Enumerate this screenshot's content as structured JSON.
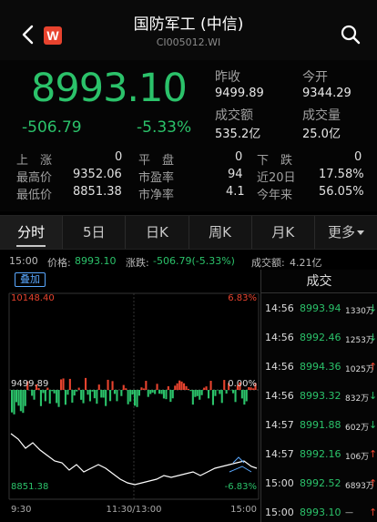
{
  "header": {
    "title": "国防军工 (中信)",
    "code": "CI005012.WI",
    "logo_letter": "W"
  },
  "quote": {
    "price": "8993.10",
    "change": "-506.79",
    "change_pct": "-5.33%",
    "prev_close_label": "昨收",
    "prev_close": "9499.89",
    "open_label": "今开",
    "open": "9344.29",
    "turnover_label": "成交额",
    "turnover": "535.2亿",
    "volume_label": "成交量",
    "volume": "25.0亿"
  },
  "stats": {
    "up_label": "上　涨",
    "up_value": "0",
    "flat_label": "平　盘",
    "flat_value": "0",
    "down_label": "下　跌",
    "down_value": "0",
    "high_label": "最高价",
    "high_value": "9352.06",
    "pe_label": "市盈率",
    "pe_value": "94",
    "d20_label": "近20日",
    "d20_value": "17.58%",
    "low_label": "最低价",
    "low_value": "8851.38",
    "pb_label": "市净率",
    "pb_value": "4.1",
    "ytd_label": "今年来",
    "ytd_value": "56.05%"
  },
  "tabs": [
    {
      "label": "分时"
    },
    {
      "label": "5日"
    },
    {
      "label": "日K"
    },
    {
      "label": "周K"
    },
    {
      "label": "月K"
    },
    {
      "label": "更多"
    }
  ],
  "infobar": {
    "time": "15:00",
    "price_label": "价格:",
    "price": "8993.10",
    "change_label": "涨跌:",
    "change": "-506.79(-5.33%)",
    "volume_label": "成交额:",
    "volume": "4.21亿"
  },
  "chart": {
    "overlay_label": "叠加",
    "top_price": "10148.40",
    "top_pct": "6.83%",
    "mid_price": "9499.89",
    "mid_pct": "0.00%",
    "bottom_price": "8851.38",
    "bottom_pct": "-6.83%",
    "x_start": "9:30",
    "x_mid": "11:30/13:00",
    "x_end": "15:00",
    "colors": {
      "up": "#e8432e",
      "down": "#2bc26a",
      "line": "#ffffff"
    }
  },
  "trades": {
    "title": "成交",
    "rows": [
      {
        "time": "14:56",
        "price": "8993.94",
        "vol": "1330万",
        "dir": "down"
      },
      {
        "time": "14:56",
        "price": "8992.46",
        "vol": "1253万",
        "dir": "down"
      },
      {
        "time": "14:56",
        "price": "8994.36",
        "vol": "1025万",
        "dir": "up"
      },
      {
        "time": "14:56",
        "price": "8993.32",
        "vol": "832万",
        "dir": "down"
      },
      {
        "time": "14:57",
        "price": "8991.88",
        "vol": "602万",
        "dir": "down"
      },
      {
        "time": "14:57",
        "price": "8992.16",
        "vol": "106万",
        "dir": "up"
      },
      {
        "time": "15:00",
        "price": "8992.52",
        "vol": "6893万",
        "dir": "up"
      },
      {
        "time": "15:00",
        "price": "8993.10",
        "vol": "—",
        "dir": "up"
      }
    ]
  }
}
